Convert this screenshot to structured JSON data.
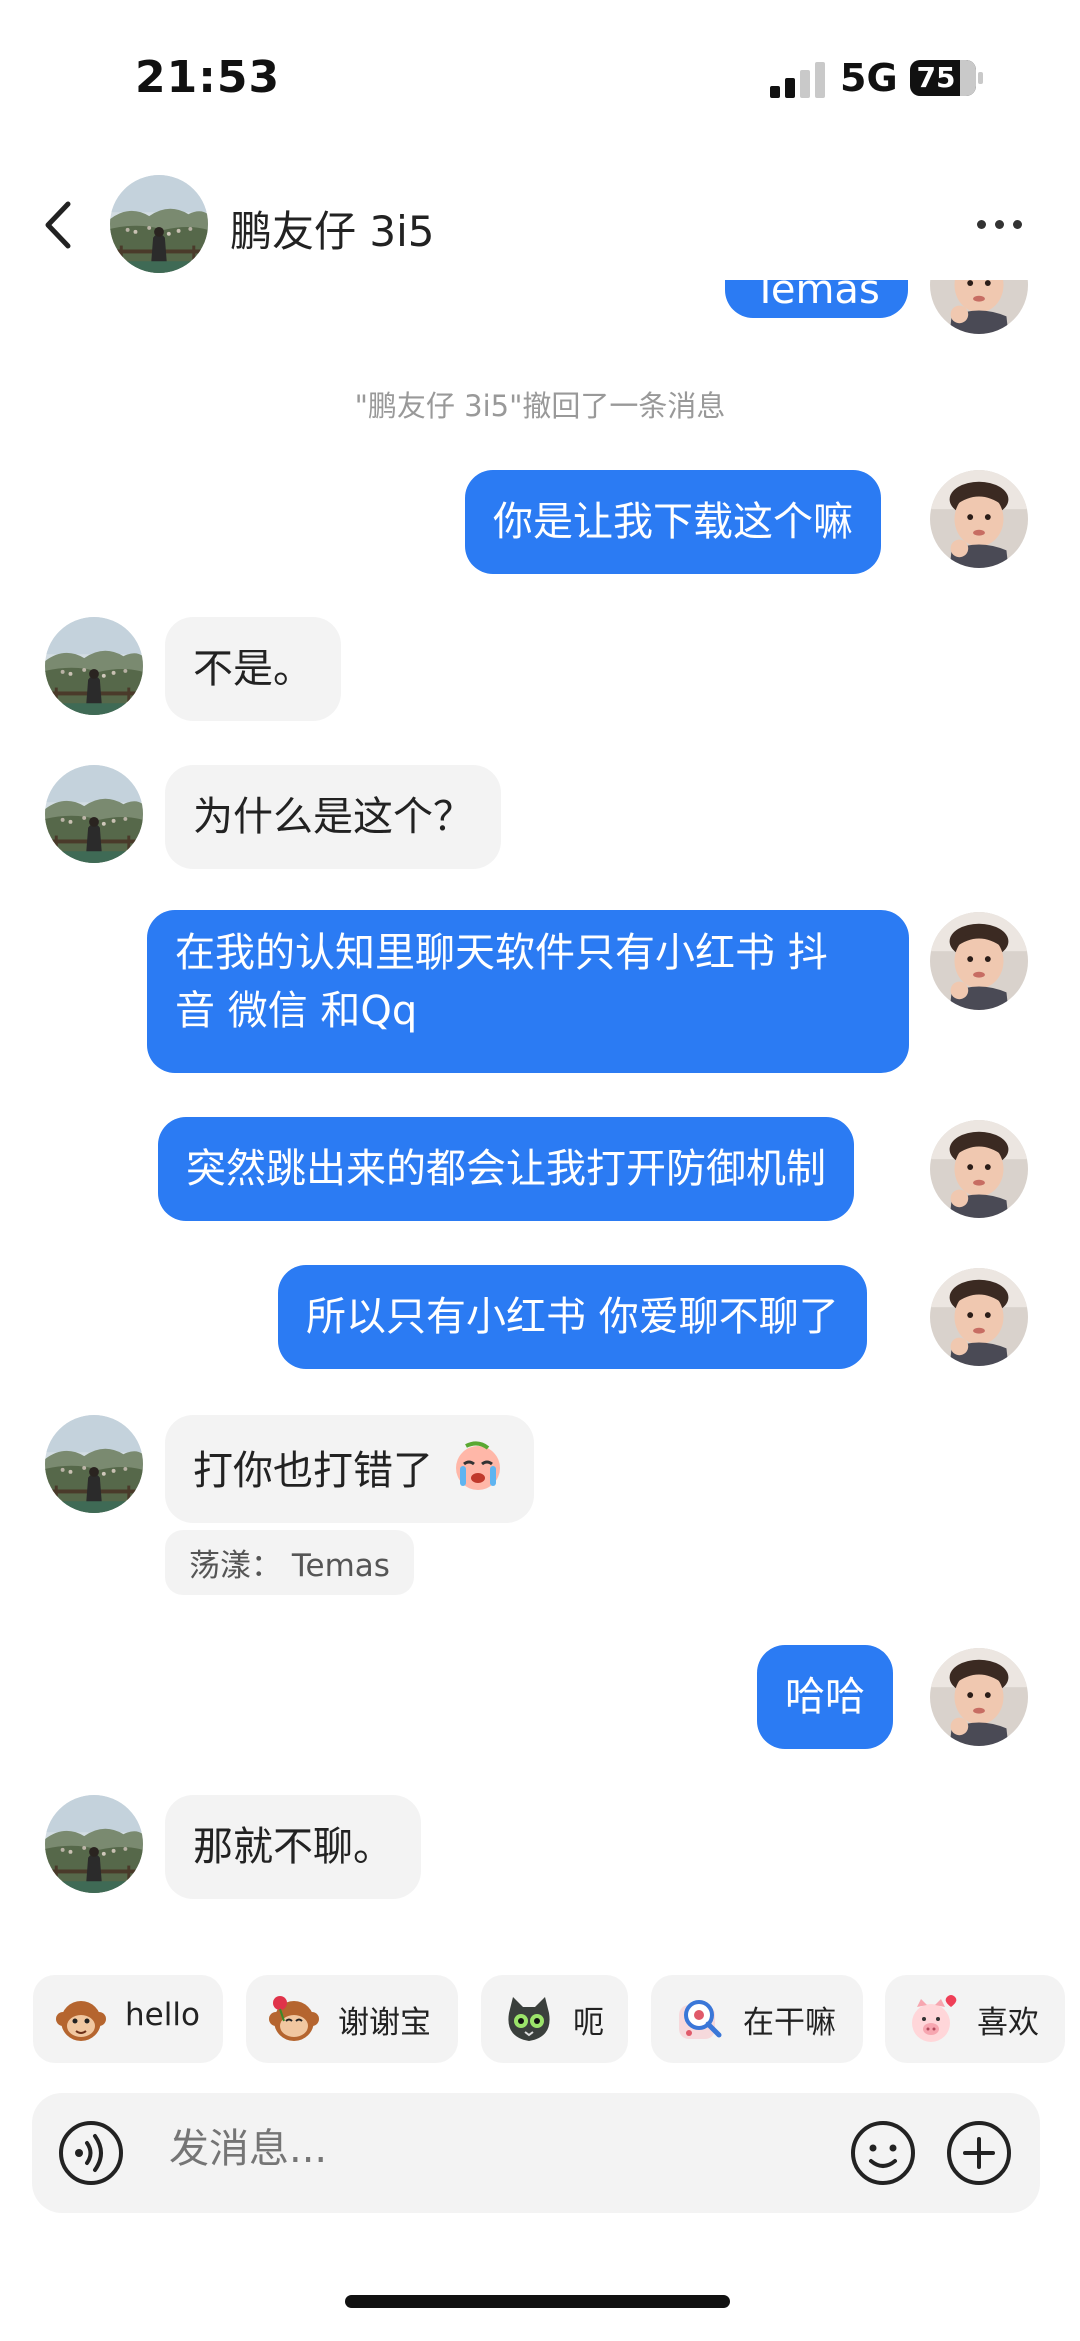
{
  "status_bar": {
    "time": "21:53",
    "network": "5G",
    "battery": "75"
  },
  "header": {
    "contact_name": "鹏友仔 3i5"
  },
  "chat": {
    "partial_top_message": "Temas",
    "recall_notice": "\"鹏友仔 3i5\"撤回了一条消息",
    "messages": [
      {
        "side": "out",
        "text": "你是让我下载这个嘛"
      },
      {
        "side": "in",
        "text": "不是。"
      },
      {
        "side": "in",
        "text": "为什么是这个？"
      },
      {
        "side": "out",
        "lines": [
          "在我的认知里聊天软件只有小红书 抖",
          "音 微信 和Qq"
        ]
      },
      {
        "side": "out",
        "text": "突然跳出来的都会让我打开防御机制"
      },
      {
        "side": "out",
        "text": "所以只有小红书 你爱聊不聊了"
      },
      {
        "side": "in",
        "text": "打你也打错了",
        "emoji": "crying-face-icon",
        "reaction": "荡漾：  Temas"
      },
      {
        "side": "out",
        "text": "哈哈"
      },
      {
        "side": "in",
        "text": "那就不聊。"
      }
    ]
  },
  "quick_replies": [
    {
      "label": "hello",
      "icon": "monkey-sticker-icon"
    },
    {
      "label": "谢谢宝",
      "icon": "monkey-rose-sticker-icon"
    },
    {
      "label": "呃",
      "icon": "cat-sticker-icon"
    },
    {
      "label": "在干嘛",
      "icon": "search-sticker-icon"
    },
    {
      "label": "喜欢",
      "icon": "pig-heart-sticker-icon"
    }
  ],
  "input": {
    "placeholder": "发消息..."
  },
  "colors": {
    "outgoing_bubble": "#2b7bf3",
    "incoming_bubble": "#f3f3f3",
    "background": "#ffffff"
  }
}
